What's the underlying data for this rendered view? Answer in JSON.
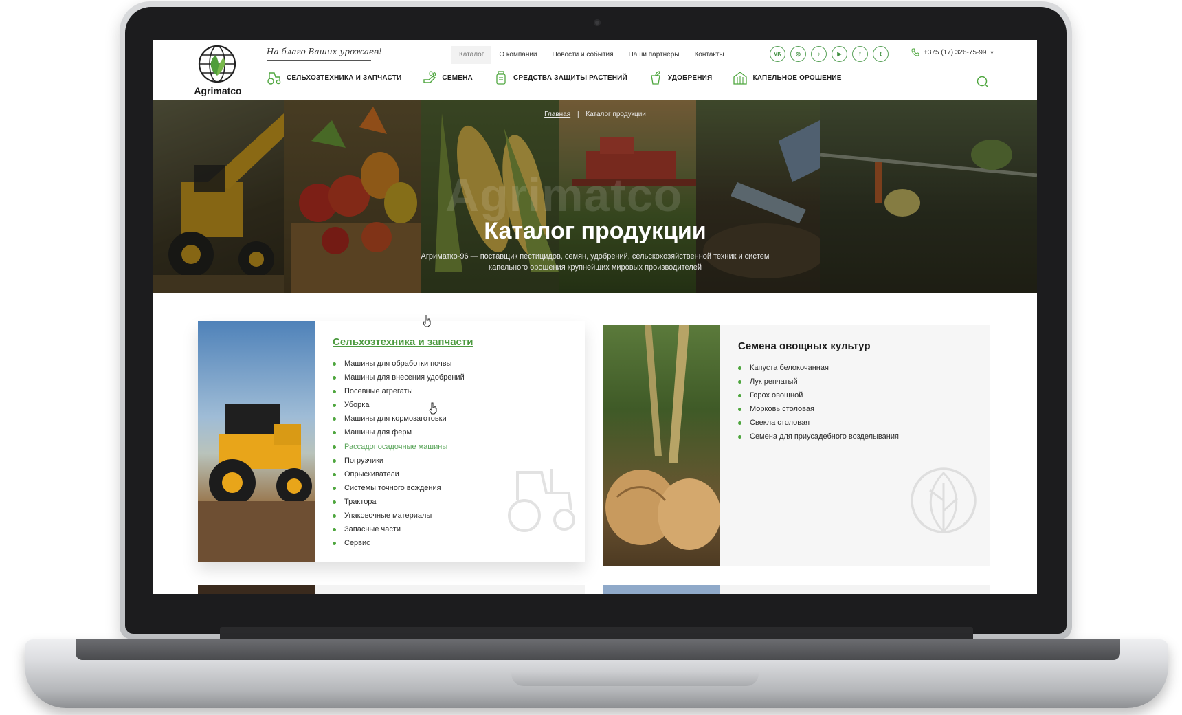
{
  "header": {
    "logo_text": "Agrimatco",
    "slogan": "На благо Ваших урожаев!",
    "top_nav": [
      {
        "label": "Каталог",
        "active": true
      },
      {
        "label": "О компании",
        "active": false
      },
      {
        "label": "Новости и события",
        "active": false
      },
      {
        "label": "Наши партнеры",
        "active": false
      },
      {
        "label": "Контакты",
        "active": false
      }
    ],
    "socials": [
      {
        "name": "vk-icon",
        "glyph": "VK"
      },
      {
        "name": "instagram-icon",
        "glyph": "◎"
      },
      {
        "name": "tiktok-icon",
        "glyph": "♪"
      },
      {
        "name": "youtube-icon",
        "glyph": "▶"
      },
      {
        "name": "facebook-icon",
        "glyph": "f"
      },
      {
        "name": "twitter-icon",
        "glyph": "t"
      }
    ],
    "phone": "+375 (17) 326-75-99",
    "main_nav": [
      {
        "label": "СЕЛЬХОЗТЕХНИКА И ЗАПЧАСТИ",
        "icon": "tractor-icon"
      },
      {
        "label": "СЕМЕНА",
        "icon": "seeds-icon"
      },
      {
        "label": "СРЕДСТВА ЗАЩИТЫ РАСТЕНИЙ",
        "icon": "bottle-icon"
      },
      {
        "label": "УДОБРЕНИЯ",
        "icon": "fertilizer-icon"
      },
      {
        "label": "КАПЕЛЬНОЕ ОРОШЕНИЕ",
        "icon": "greenhouse-icon"
      }
    ]
  },
  "hero": {
    "breadcrumb_home": "Главная",
    "breadcrumb_sep": "|",
    "breadcrumb_current": "Каталог продукции",
    "watermark": "Agrimatco",
    "title": "Каталог продукции",
    "description": "Агриматко-96 — поставщик пестицидов, семян, удобрений, сельскохозяйственной техник и систем капельного орошения крупнейших мировых производителей"
  },
  "cards": [
    {
      "title": "Сельхозтехника и запчасти",
      "items": [
        "Машины для обработки почвы",
        "Машины для внесения удобрений",
        "Посевные агрегаты",
        "Уборка",
        "Машины для кормозаготовки",
        "Машины для ферм",
        "Рассадопосадочные машины",
        "Погрузчики",
        "Опрыскиватели",
        "Системы точного вождения",
        "Трактора",
        "Упаковочные материалы",
        "Запасные части",
        "Сервис"
      ],
      "highlighted_index": 6
    },
    {
      "title": "Семена овощных культур",
      "items": [
        "Капуста белокочанная",
        "Лук репчатый",
        "Горох овощной",
        "Морковь столовая",
        "Свекла столовая",
        "Семена для приусадебного возделывания"
      ]
    }
  ],
  "colors": {
    "accent_green": "#4ea63e",
    "link_green": "#4c9a3f",
    "text_dark": "#2c2c2c"
  }
}
